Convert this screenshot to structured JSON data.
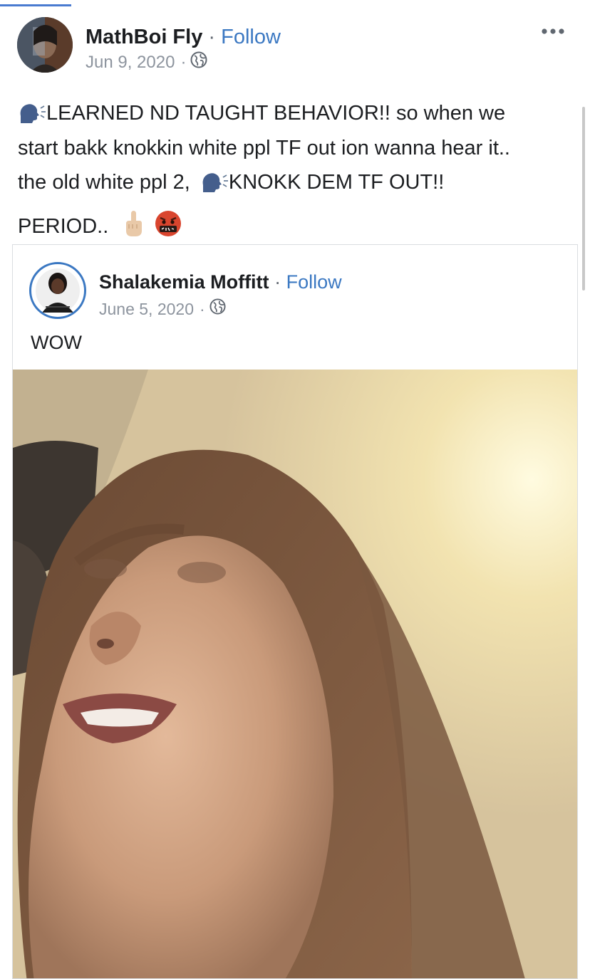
{
  "post": {
    "author": "MathBoi Fly",
    "separator": "·",
    "follow_label": "Follow",
    "date": "Jun 9, 2020",
    "date_separator": "·",
    "privacy_icon": "globe-icon",
    "more_icon": "more-options-icon",
    "text": {
      "line1": "LEARNED ND TAUGHT BEHAVIOR!! so when we",
      "line2": "start bakk knokkin white ppl TF out ion wanna hear it..",
      "line3a": "the old white ppl 2,",
      "line3b": "KNOKK DEM TF OUT!!",
      "line4": "PERIOD.."
    },
    "emojis": [
      "speaking-head-icon",
      "speaking-head-icon",
      "middle-finger-icon",
      "cursing-face-icon"
    ]
  },
  "shared_post": {
    "author": "Shalakemia Moffitt",
    "separator": "·",
    "follow_label": "Follow",
    "date": "June 5, 2020",
    "date_separator": "·",
    "privacy_icon": "globe-icon",
    "text": "WOW",
    "media_type": "video-still"
  },
  "colors": {
    "link": "#3b78c2",
    "meta": "#8d949e",
    "text": "#1c1e21",
    "border": "#dadde1"
  }
}
